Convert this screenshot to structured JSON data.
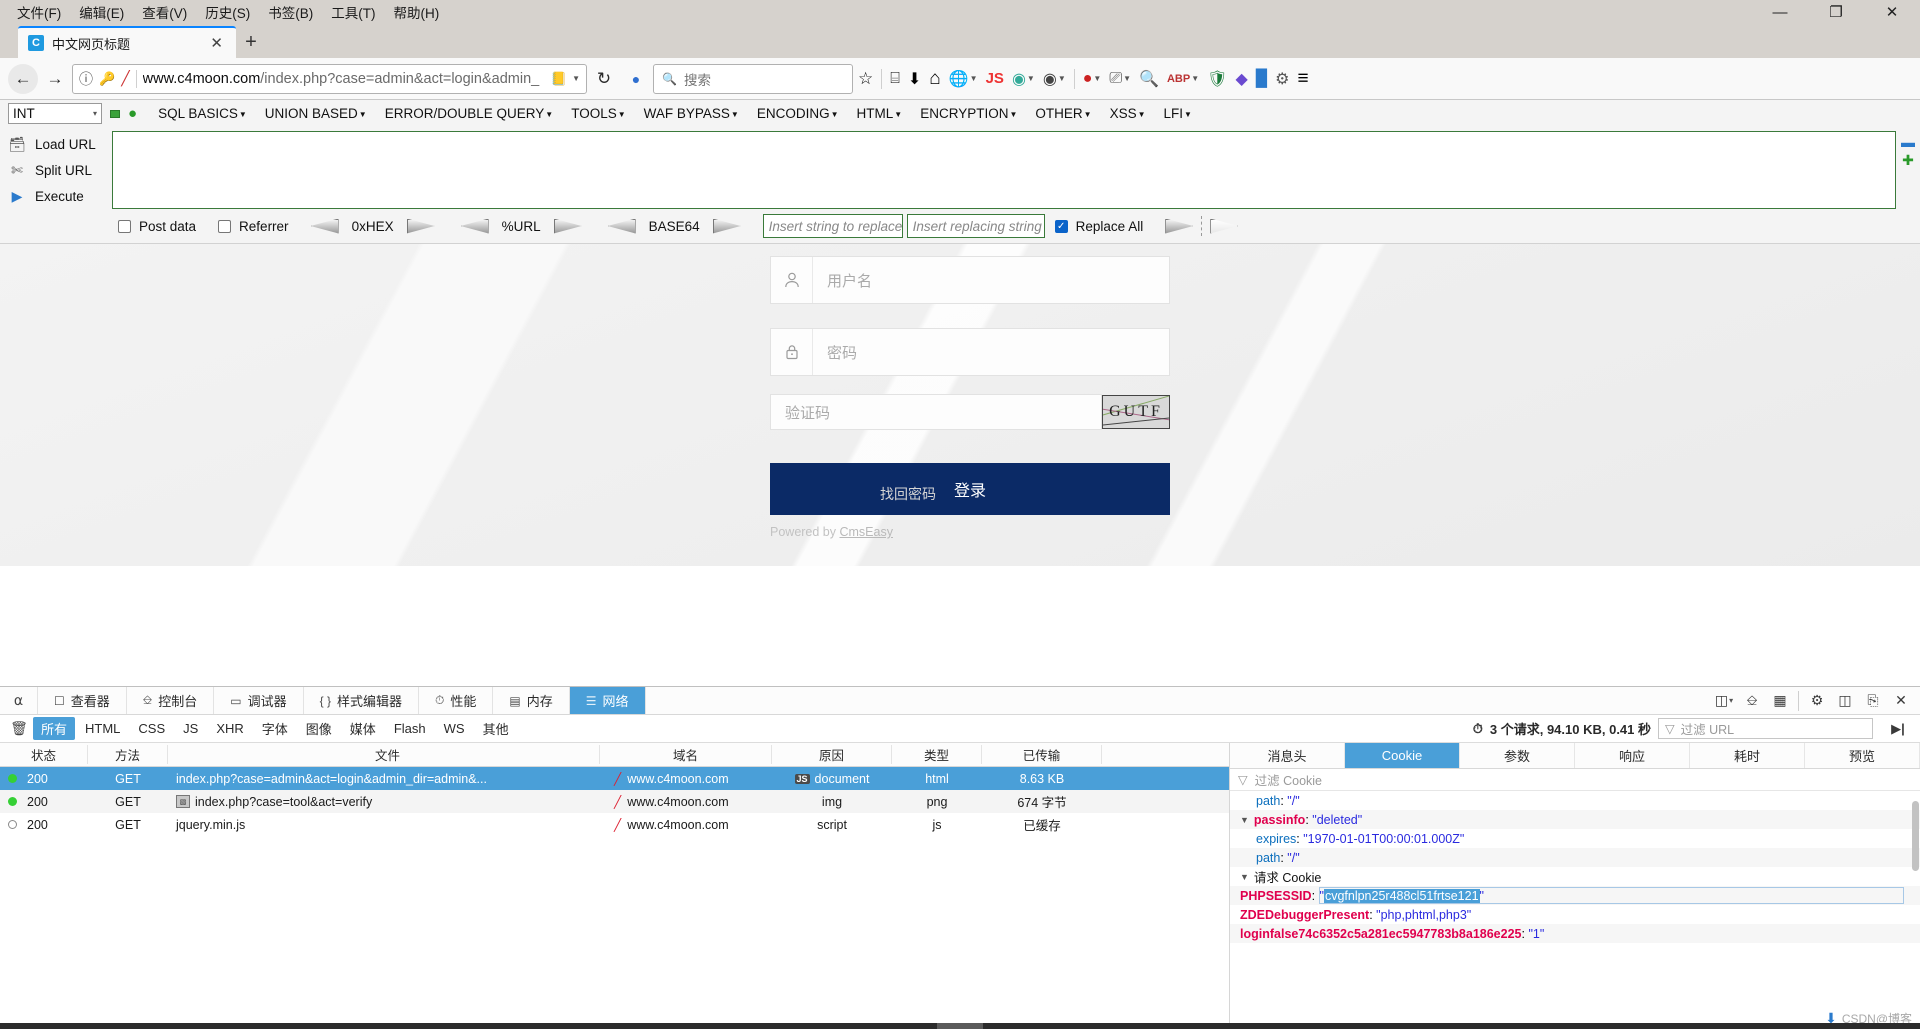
{
  "window": {
    "menus": [
      {
        "label": "文件(F)",
        "accel": "F"
      },
      {
        "label": "编辑(E)",
        "accel": "E"
      },
      {
        "label": "查看(V)",
        "accel": "V"
      },
      {
        "label": "历史(S)",
        "accel": "S"
      },
      {
        "label": "书签(B)",
        "accel": "B"
      },
      {
        "label": "工具(T)",
        "accel": "T"
      },
      {
        "label": "帮助(H)",
        "accel": "H"
      }
    ],
    "controls": {
      "minimize": "—",
      "maximize": "❐",
      "close": "✕"
    }
  },
  "tabs": {
    "active": {
      "title": "中文网页标题",
      "favicon_letter": "C",
      "close": "✕"
    },
    "newtab": "+"
  },
  "navbar": {
    "back": "←",
    "forward": "→",
    "reload": "↻",
    "url_protocol_host": "www.c4moon.com",
    "url_path": "/index.php?case=admin&act=login&admin_",
    "identity_icon": "ⓘ",
    "search_placeholder": "搜索",
    "bookmark_star": "☆",
    "library": "⌸",
    "downloads": "⬇",
    "home": "⌂",
    "menu": "≡"
  },
  "hackbar": {
    "mode_select": "INT",
    "menus": [
      "SQL BASICS",
      "UNION BASED",
      "ERROR/DOUBLE QUERY",
      "TOOLS",
      "WAF BYPASS",
      "ENCODING",
      "HTML",
      "ENCRYPTION",
      "OTHER",
      "XSS",
      "LFI"
    ],
    "actions": [
      {
        "label": "Load URL",
        "icon": "load-url-icon"
      },
      {
        "label": "Split URL",
        "icon": "split-url-icon"
      },
      {
        "label": "Execute",
        "icon": "execute-icon"
      }
    ],
    "textarea_value": "",
    "options": {
      "post_data": {
        "label": "Post data",
        "checked": false
      },
      "referrer": {
        "label": "Referrer",
        "checked": false
      },
      "replace_all": {
        "label": "Replace All",
        "checked": true
      }
    },
    "encoders": [
      "0xHEX",
      "%URL",
      "BASE64"
    ],
    "replace_from_placeholder": "Insert string to replace",
    "replace_to_placeholder": "Insert replacing string"
  },
  "page": {
    "username_placeholder": "用户名",
    "password_placeholder": "密码",
    "captcha_placeholder": "验证码",
    "captcha_text": "GUTF",
    "login_button": "登录",
    "powered_prefix": "Powered by ",
    "powered_link": "CmsEasy",
    "forgot_password": "找回密码"
  },
  "devtools": {
    "tabs": [
      {
        "label": "查看器",
        "icon": "inspector-icon",
        "active": false
      },
      {
        "label": "控制台",
        "icon": "console-icon",
        "active": false
      },
      {
        "label": "调试器",
        "icon": "debugger-icon",
        "active": false
      },
      {
        "label": "样式编辑器",
        "icon": "style-editor-icon",
        "active": false
      },
      {
        "label": "性能",
        "icon": "performance-icon",
        "active": false
      },
      {
        "label": "内存",
        "icon": "memory-icon",
        "active": false
      },
      {
        "label": "网络",
        "icon": "network-icon",
        "active": true
      }
    ],
    "picker_icon": "element-picker-icon",
    "right_icons": [
      "responsive-design-icon",
      "split-console-icon",
      "screenshot-icon",
      "settings-gear-icon",
      "dock-side-icon",
      "dock-window-icon",
      "close-icon"
    ],
    "filters": [
      {
        "label": "所有",
        "active": true
      },
      {
        "label": "HTML",
        "active": false
      },
      {
        "label": "CSS",
        "active": false
      },
      {
        "label": "JS",
        "active": false
      },
      {
        "label": "XHR",
        "active": false
      },
      {
        "label": "字体",
        "active": false
      },
      {
        "label": "图像",
        "active": false
      },
      {
        "label": "媒体",
        "active": false
      },
      {
        "label": "Flash",
        "active": false
      },
      {
        "label": "WS",
        "active": false
      },
      {
        "label": "其他",
        "active": false
      }
    ],
    "trash_icon": "clear-requests-icon",
    "summary": "3 个请求, 94.10 KB, 0.41 秒",
    "url_filter_placeholder": "过滤 URL",
    "persist_icon": "persist-logs-icon",
    "table": {
      "columns": [
        "状态",
        "方法",
        "文件",
        "域名",
        "原因",
        "类型",
        "已传输"
      ],
      "rows": [
        {
          "status": "200",
          "status_dot": "green",
          "method": "GET",
          "file": "index.php?case=admin&act=login&admin_dir=admin&...",
          "file_icon": "none",
          "domain": "www.c4moon.com",
          "domain_icon": "tracking-shield-icon",
          "reason": "document",
          "reason_badge": "JS",
          "type": "html",
          "transferred": "8.63 KB",
          "selected": true
        },
        {
          "status": "200",
          "status_dot": "green",
          "method": "GET",
          "file": "index.php?case=tool&act=verify",
          "file_icon": "image-thumb-icon",
          "domain": "www.c4moon.com",
          "domain_icon": "tracking-shield-icon",
          "reason": "img",
          "reason_badge": "",
          "type": "png",
          "transferred": "674 字节",
          "selected": false
        },
        {
          "status": "200",
          "status_dot": "hollow",
          "method": "GET",
          "file": "jquery.min.js",
          "file_icon": "none",
          "domain": "www.c4moon.com",
          "domain_icon": "tracking-shield-icon",
          "reason": "script",
          "reason_badge": "",
          "type": "js",
          "transferred": "已缓存",
          "selected": false
        }
      ]
    },
    "inspector": {
      "tabs": [
        {
          "label": "消息头",
          "active": false
        },
        {
          "label": "Cookie",
          "active": true
        },
        {
          "label": "参数",
          "active": false
        },
        {
          "label": "响应",
          "active": false
        },
        {
          "label": "耗时",
          "active": false
        },
        {
          "label": "预览",
          "active": false
        }
      ],
      "filter_placeholder": "过滤 Cookie",
      "entries": [
        {
          "kind": "attr",
          "indent": 1,
          "key": "path",
          "value": "\"/\""
        },
        {
          "kind": "cookie",
          "indent": 0,
          "key": "passinfo",
          "value": "\"deleted\"",
          "expandable": true
        },
        {
          "kind": "attr",
          "indent": 1,
          "key": "expires",
          "value": "\"1970-01-01T00:00:01.000Z\""
        },
        {
          "kind": "attr",
          "indent": 1,
          "key": "path",
          "value": "\"/\""
        },
        {
          "kind": "group",
          "indent": 0,
          "key": "请求 Cookie",
          "value": "",
          "expandable": true
        },
        {
          "kind": "cookie",
          "indent": 0,
          "key": "PHPSESSID",
          "value": "\"cvgfnlpn25r488cl51frtse121\"",
          "editing": true,
          "selection": "cvgfnlpn25r488cl51frtse121"
        },
        {
          "kind": "cookie",
          "indent": 0,
          "key": "ZDEDebuggerPresent",
          "value": "\"php,phtml,php3\""
        },
        {
          "kind": "cookie",
          "indent": 0,
          "key": "loginfalse74c6352c5a281ec5947783b8a186e225",
          "value": "\"1\""
        }
      ]
    }
  },
  "colors": {
    "accent_blue": "#4a9fd8",
    "chrome_gray": "#d6d2cd",
    "login_navy": "#0b2a66",
    "hackbar_green": "#3a7a3a",
    "checked_blue": "#0a63c9",
    "status_green": "#35d035",
    "cookie_key_red": "#e0004d",
    "cookie_value_blue": "#2a2adf"
  }
}
